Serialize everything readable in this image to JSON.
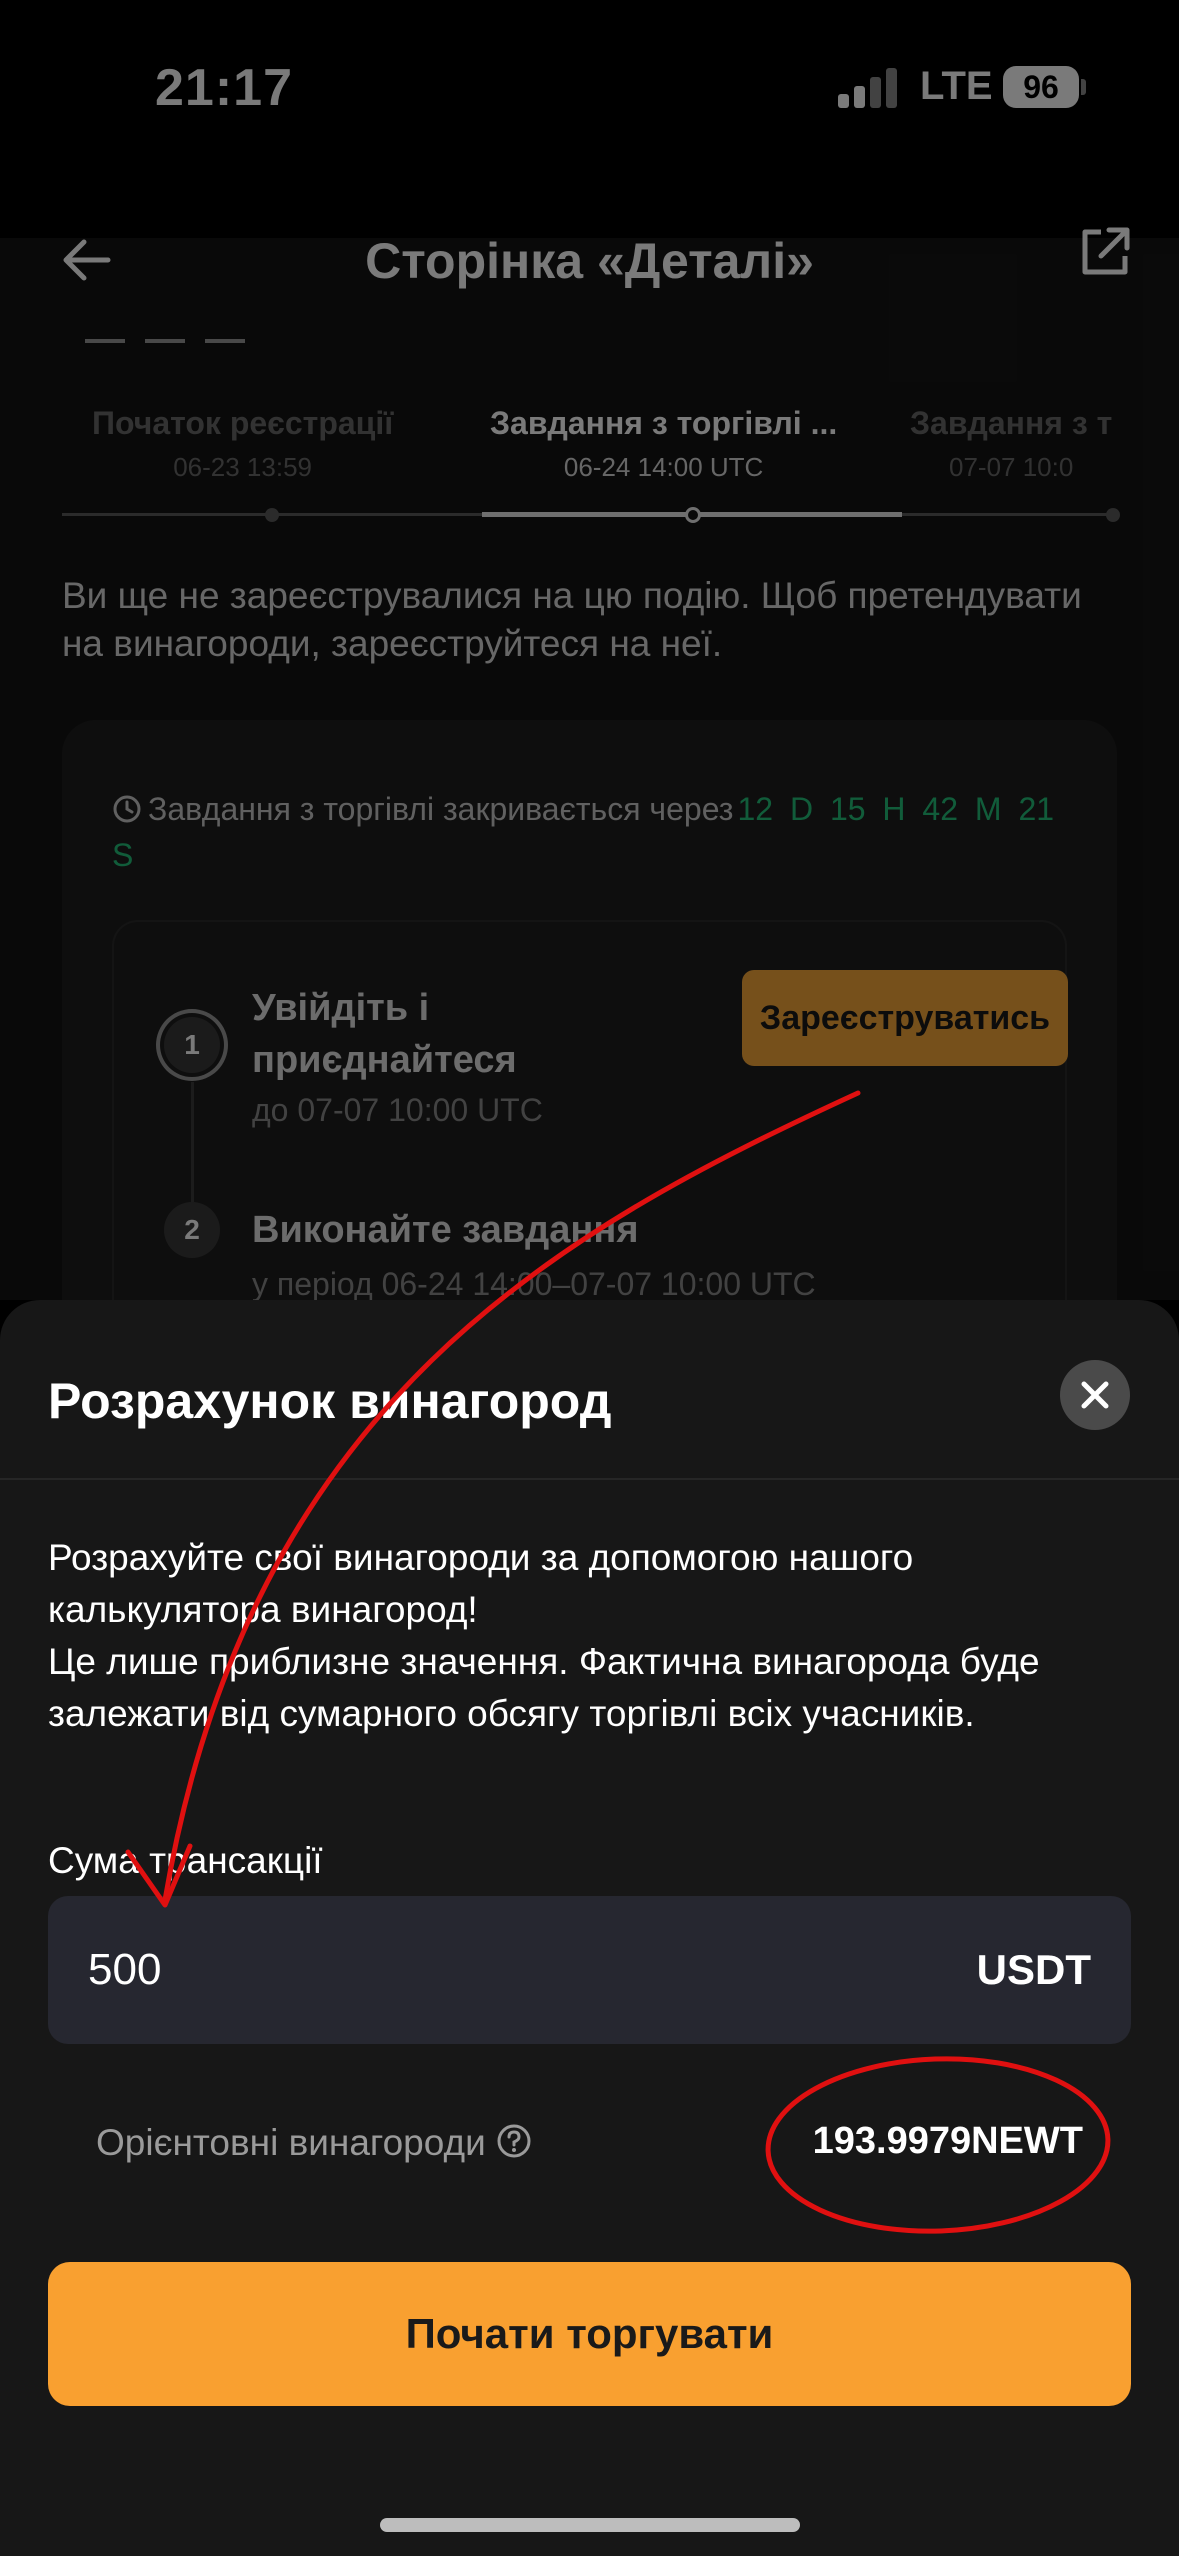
{
  "status_bar": {
    "time": "21:17",
    "network": "LTE",
    "battery": "96"
  },
  "header": {
    "title": "Сторінка «Деталі»"
  },
  "timeline": {
    "tabs": [
      {
        "name": "Початок реєстрації",
        "date": "06-23 13:59"
      },
      {
        "name": "Завдання з торгівлі ...",
        "date": "06-24 14:00 UTC"
      },
      {
        "name": "Завдання з т",
        "date": "07-07 10:0"
      }
    ]
  },
  "notice": "Ви ще не зареєструвалися на цю подію. Щоб претендувати на винагороди, зареєструйтеся на неї.",
  "task_card": {
    "countdown_label": "Завдання з торгівлі закривається через",
    "countdown_timer": "12 D 15 H 42 M 21 S",
    "steps": [
      {
        "number": "1",
        "title": "Увійдіть і приєднайтеся",
        "subtitle": "до 07-07 10:00 UTC"
      },
      {
        "number": "2",
        "title": "Виконайте завдання",
        "subtitle": "у період 06-24 14:00–07-07 10:00 UTC"
      }
    ],
    "register_label": "Зареєструватись"
  },
  "sheet": {
    "title": "Розрахунок винагород",
    "description_lines": [
      "Розрахуйте свої винагороди за допомогою нашого калькулятора винагород!",
      "Це лише приблизне значення. Фактична винагорода буде залежати від сумарного обсягу торгівлі всіх учасників."
    ],
    "amount_label": "Сума трансакції",
    "amount_value": "500",
    "amount_unit": "USDT",
    "estimated_label": "Орієнтовні винагороди",
    "estimated_value": "193.9979NEWT",
    "start_button": "Почати торгувати"
  },
  "colors": {
    "accent": "#F9A030",
    "timer_green": "#25C17A",
    "annotation_red": "#E01010",
    "sheet_bg": "#171717",
    "field_bg": "#262730"
  }
}
